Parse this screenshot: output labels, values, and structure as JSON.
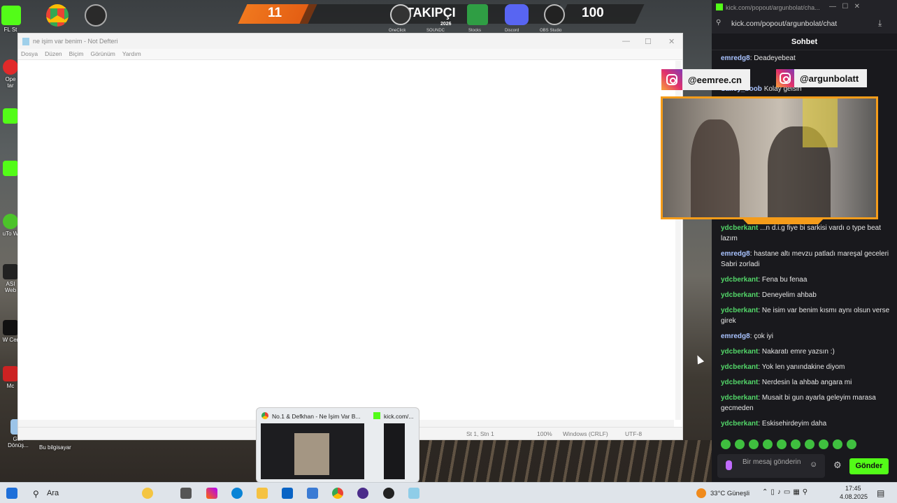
{
  "desktop": {
    "left_icon_labels": [
      "FL St",
      "Ope tar",
      "uTo W",
      "ASI Web",
      "W Cer",
      "Mc",
      "Geri Dönüş..."
    ],
    "pc_icon_label": "Bu bilgisayar"
  },
  "overlay": {
    "left_count": "11",
    "takipci_label": "TAKIPÇI",
    "right_count": "100",
    "year_badge": "2026",
    "taskbar_icon_labels": [
      "OneClick",
      "SOUNDC",
      "Stocks",
      "Discord",
      "OBS Studio"
    ]
  },
  "notepad": {
    "title": "ne işim var benim - Not Defteri",
    "menu": [
      "Dosya",
      "Düzen",
      "Biçim",
      "Görünüm",
      "Yardım"
    ],
    "status": {
      "position": "St 1, Stn 1",
      "zoom": "100%",
      "eol": "Windows (CRLF)",
      "encoding": "UTF-8"
    }
  },
  "chat": {
    "window_title": "kick.com/popout/argunbolat/cha...",
    "url": "kick.com/popout/argunbolat/chat",
    "header": "Sohbet",
    "messages": [
      {
        "user": "emredg8",
        "text": "Deadeyebeat",
        "color": "blue"
      },
      {
        "user": "Salley_boob",
        "text": "Kolay gelsin",
        "color": "blue"
      },
      {
        "user": "ydcberkant",
        "text": "...n d.i.g fiye bi sarkisi vardı o type beat lazım",
        "color": "green"
      },
      {
        "user": "emredg8",
        "text": "hastane altı mevzu patladı mareşal geceleri Sabri zorladi",
        "color": "blue"
      },
      {
        "user": "ydcberkant",
        "text": "Fena bu fenaa",
        "color": "green"
      },
      {
        "user": "ydcberkant",
        "text": "Deneyelim ahbab",
        "color": "green"
      },
      {
        "user": "ydcberkant",
        "text": "Ne isim var benim kısmı aynı olsun verse girek",
        "color": "green"
      },
      {
        "user": "emredg8",
        "text": "çok iyi",
        "color": "blue"
      },
      {
        "user": "ydcberkant",
        "text": "Nakaratı emre yazsın :)",
        "color": "green"
      },
      {
        "user": "ydcberkant",
        "text": "Yok len yanındakine diyom",
        "color": "green"
      },
      {
        "user": "ydcberkant",
        "text": "Nerdesin la ahbab angara mi",
        "color": "green"
      },
      {
        "user": "ydcberkant",
        "text": "Musait bi gun ayarla geleyim marasa gecmeden",
        "color": "green"
      },
      {
        "user": "ydcberkant",
        "text": "Eskisehirdeyim daha",
        "color": "green"
      }
    ],
    "input_placeholder": "Bir mesaj gönderin",
    "send_label": "Gönder"
  },
  "social": {
    "handle1": "@eemree.cn",
    "handle2": "@argunbolatt"
  },
  "popup": {
    "tab1": "No.1 & Defkhan - Ne İşim Var B...",
    "tab2": "kick.com/..."
  },
  "taskbar": {
    "search_label": "Ara",
    "weather": "33°C Güneşli",
    "time": "17:45",
    "date": "4.08.2025"
  },
  "colors": {
    "kick_green": "#53fc18",
    "accent_orange": "#f59c1a",
    "chat_bg": "#19191d"
  }
}
